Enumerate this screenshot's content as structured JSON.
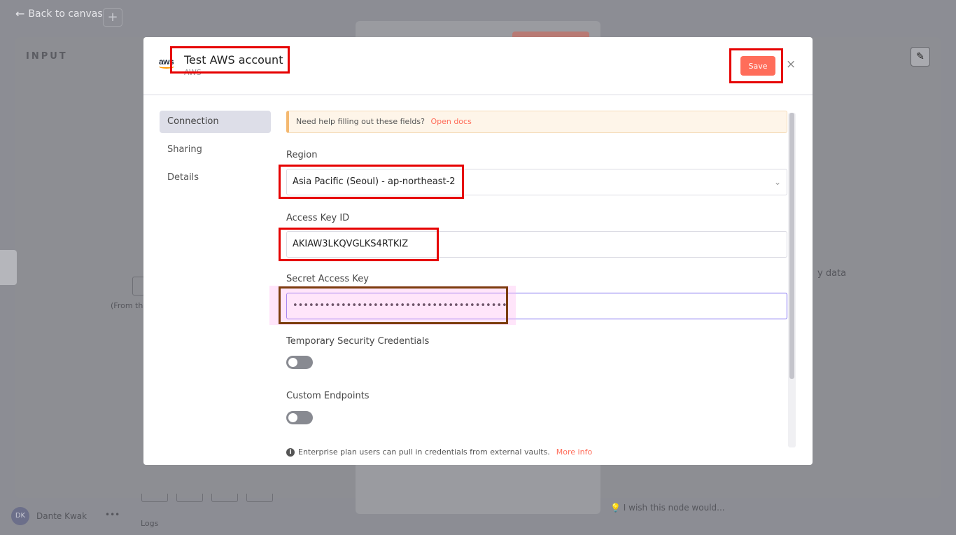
{
  "background": {
    "back_link": "Back to canvas",
    "plus": "+",
    "input_label": "INPUT",
    "from_text": "(From the",
    "data_text": "y data",
    "user_name": "Dante Kwak",
    "user_initials": "DK",
    "more": "•••",
    "wish_text": "I wish this node would...",
    "logs": "Logs"
  },
  "modal": {
    "title": "Test AWS account",
    "subtitle": "AWS",
    "logo_text": "aws",
    "save_label": "Save",
    "close_icon": "×",
    "tabs": [
      {
        "label": "Connection",
        "active": true
      },
      {
        "label": "Sharing",
        "active": false
      },
      {
        "label": "Details",
        "active": false
      }
    ],
    "notice": {
      "text": "Need help filling out these fields?",
      "link": "Open docs"
    },
    "fields": {
      "region_label": "Region",
      "region_value": "Asia Pacific (Seoul) - ap-northeast-2",
      "access_key_label": "Access Key ID",
      "access_key_value": "AKIAW3LKQVGLKS4RTKIZ",
      "secret_key_label": "Secret Access Key",
      "secret_key_value": "••••••••••••••••••••••••••••••••••••••••",
      "temp_creds_label": "Temporary Security Credentials",
      "custom_endpoints_label": "Custom Endpoints"
    },
    "enterprise": {
      "text": "Enterprise plan users can pull in credentials from external vaults.",
      "link": "More info"
    }
  },
  "colors": {
    "accent": "#ff6d5a",
    "highlight_red": "#e60000",
    "highlight_brown": "#7c3d0c",
    "focus": "#7c6cf0"
  }
}
